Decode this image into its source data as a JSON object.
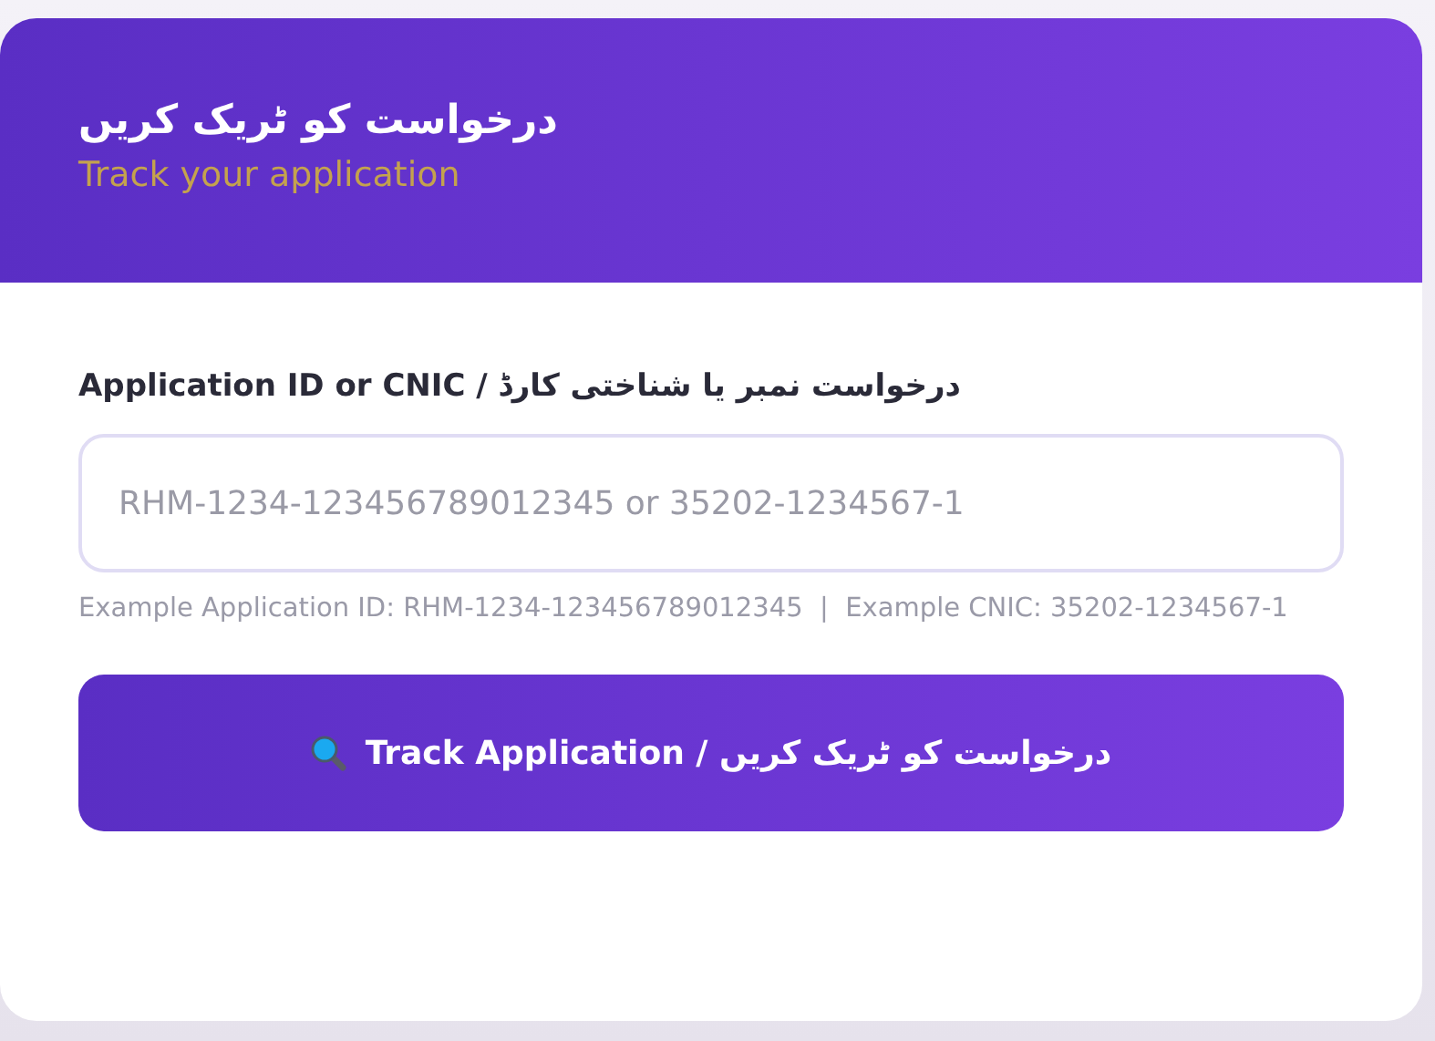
{
  "header": {
    "title": "درخواست کو ٹریک کریں",
    "subtitle": "Track your application"
  },
  "form": {
    "label": "Application ID or CNIC / درخواست نمبر یا شناختی کارڈ",
    "placeholder": "RHM-1234-123456789012345 or 35202-1234567-1",
    "hint": "Example Application ID: RHM-1234-123456789012345  |  Example CNIC: 35202-1234567-1"
  },
  "button": {
    "label": "Track Application /  درخواست کو ٹریک کریں"
  }
}
